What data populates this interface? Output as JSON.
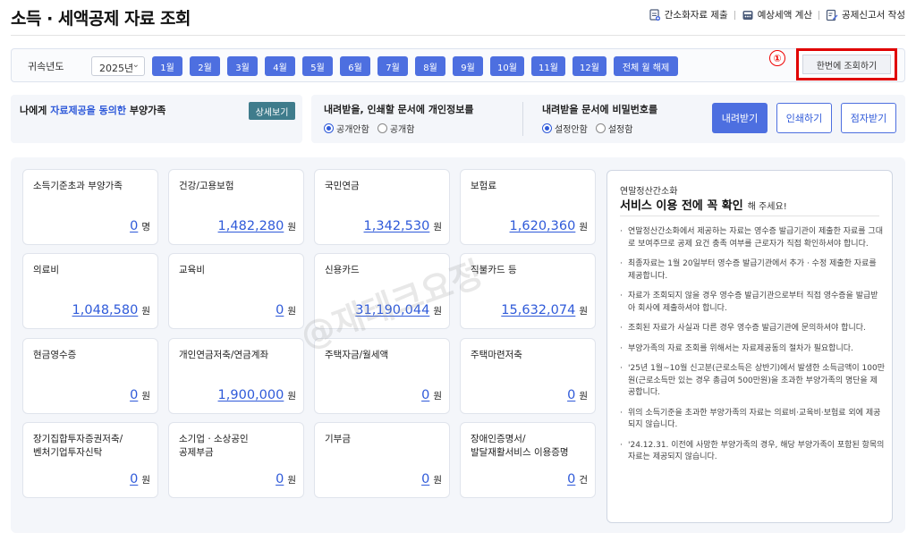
{
  "header": {
    "title": "소득 · 세액공제 자료 조회",
    "links": [
      {
        "label": "간소화자료 제출",
        "icon": "document-upload-icon"
      },
      {
        "label": "예상세액 계산",
        "icon": "calculator-icon"
      },
      {
        "label": "공제신고서 작성",
        "icon": "form-edit-icon"
      }
    ]
  },
  "filter": {
    "label": "귀속년도",
    "year": "2025년",
    "months": [
      "1월",
      "2월",
      "3월",
      "4월",
      "5월",
      "6월",
      "7월",
      "8월",
      "9월",
      "10월",
      "11월",
      "12월",
      "전체 월 해제"
    ],
    "marker": "①",
    "bulk_button": "한번에 조회하기"
  },
  "dependents": {
    "prefix": "나에게 ",
    "highlight": "자료제공을 동의한",
    "suffix": " 부양가족",
    "detail_button": "상세보기"
  },
  "options": {
    "personal_info": {
      "title": "내려받을, 인쇄할 문서에 개인정보를",
      "choices": [
        "공개안함",
        "공개함"
      ],
      "selected": 0
    },
    "password": {
      "title": "내려받을 문서에 비밀번호를",
      "choices": [
        "설정안함",
        "설정함"
      ],
      "selected": 0
    },
    "buttons": {
      "download": "내려받기",
      "print": "인쇄하기",
      "braille": "점자받기"
    }
  },
  "cards": [
    {
      "label": "소득기준초과 부양가족",
      "value": "0",
      "unit": "명"
    },
    {
      "label": "건강/고용보험",
      "value": "1,482,280",
      "unit": "원"
    },
    {
      "label": "국민연금",
      "value": "1,342,530",
      "unit": "원"
    },
    {
      "label": "보험료",
      "value": "1,620,360",
      "unit": "원"
    },
    {
      "label": "의료비",
      "value": "1,048,580",
      "unit": "원"
    },
    {
      "label": "교육비",
      "value": "0",
      "unit": "원"
    },
    {
      "label": "신용카드",
      "value": "31,190,044",
      "unit": "원"
    },
    {
      "label": "직불카드 등",
      "value": "15,632,074",
      "unit": "원"
    },
    {
      "label": "현금영수증",
      "value": "0",
      "unit": "원"
    },
    {
      "label": "개인연금저축/연금계좌",
      "value": "1,900,000",
      "unit": "원"
    },
    {
      "label": "주택자금/월세액",
      "value": "0",
      "unit": "원"
    },
    {
      "label": "주택마련저축",
      "value": "0",
      "unit": "원"
    },
    {
      "label": "장기집합투자증권저축/\n벤처기업투자신탁",
      "value": "0",
      "unit": "원"
    },
    {
      "label": "소기업 · 소상공인\n공제부금",
      "value": "0",
      "unit": "원"
    },
    {
      "label": "기부금",
      "value": "0",
      "unit": "원"
    },
    {
      "label": "장애인증명서/\n발달재활서비스 이용증명",
      "value": "0",
      "unit": "건"
    }
  ],
  "notice": {
    "subtitle": "연말정산간소화",
    "title": "서비스 이용 전에 꼭 확인",
    "title_tail": "해 주세요!",
    "items": [
      "연말정산간소화에서 제공하는 자료는 영수증 발급기관이 제출한 자료를 그대로 보여주므로 공제 요건 충족 여부를 근로자가 직접 확인하셔야 합니다.",
      "최종자료는 1월 20일부터 영수증 발급기관에서 추가 · 수정 제출한 자료를 제공합니다.",
      "자료가 조회되지 않을 경우 영수증 발급기관으로부터 직접 영수증을 발급받아 회사에 제출하셔야 합니다.",
      "조회된 자료가 사실과 다른 경우 영수증 발급기관에 문의하셔야 합니다.",
      "부양가족의 자료 조회를 위해서는 자료제공동의 절차가 필요합니다.",
      "'25년 1월~10월 신고분(근로소득은 상반기)에서 발생한 소득금액이 100만원(근로소득만 있는 경우 총급여 500만원)을 초과한 부양가족의 명단을 제공합니다.",
      "위의 소득기준을 초과한 부양가족의 자료는 의료비·교육비·보험료 외에 제공되지 않습니다.",
      "'24.12.31. 이전에 사망한 부양가족의 경우, 해당 부양가족이 포함된 항목의 자료는 제공되지 않습니다."
    ]
  },
  "watermark": "@재테크요정"
}
